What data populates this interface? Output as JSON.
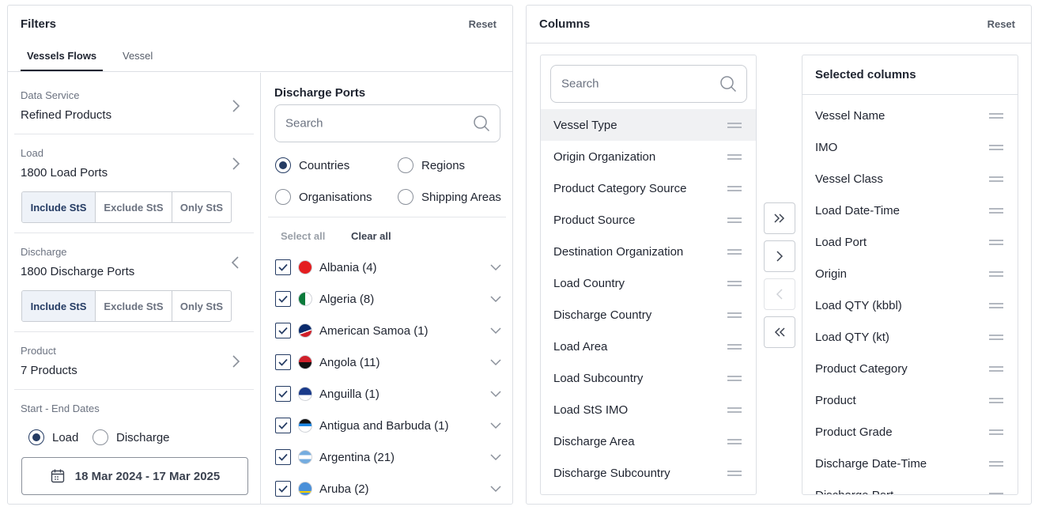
{
  "filters": {
    "title": "Filters",
    "reset": "Reset",
    "tabs": [
      {
        "label": "Vessels Flows",
        "active": true
      },
      {
        "label": "Vessel",
        "active": false
      }
    ],
    "data_service": {
      "label": "Data Service",
      "value": "Refined Products"
    },
    "load": {
      "label": "Load",
      "value": "1800 Load Ports"
    },
    "discharge": {
      "label": "Discharge",
      "value": "1800 Discharge Ports"
    },
    "sts_options": [
      "Include StS",
      "Exclude StS",
      "Only StS"
    ],
    "product": {
      "label": "Product",
      "value": "7 Products"
    },
    "dates": {
      "label": "Start - End Dates",
      "options": [
        "Load",
        "Discharge"
      ],
      "selected": "Load",
      "range": "18 Mar 2024 - 17 Mar 2025"
    },
    "discharge_ports": {
      "title": "Discharge Ports",
      "search_placeholder": "Search",
      "group_options": [
        "Countries",
        "Regions",
        "Organisations",
        "Shipping Areas"
      ],
      "selected_group": "Countries",
      "select_all": "Select all",
      "clear_all": "Clear all",
      "countries": [
        {
          "name": "Albania (4)",
          "checked": true
        },
        {
          "name": "Algeria (8)",
          "checked": true
        },
        {
          "name": "American Samoa (1)",
          "checked": true
        },
        {
          "name": "Angola (11)",
          "checked": true
        },
        {
          "name": "Anguilla (1)",
          "checked": true
        },
        {
          "name": "Antigua and Barbuda (1)",
          "checked": true
        },
        {
          "name": "Argentina (21)",
          "checked": true
        },
        {
          "name": "Aruba (2)",
          "checked": true
        }
      ]
    }
  },
  "columns": {
    "title": "Columns",
    "reset": "Reset",
    "search_placeholder": "Search",
    "available": [
      "Vessel Type",
      "Origin Organization",
      "Product Category Source",
      "Product Source",
      "Destination Organization",
      "Load Country",
      "Discharge Country",
      "Load Area",
      "Load Subcountry",
      "Load StS IMO",
      "Discharge Area",
      "Discharge Subcountry"
    ],
    "selected_title": "Selected columns",
    "selected": [
      "Vessel Name",
      "IMO",
      "Vessel Class",
      "Load Date-Time",
      "Load Port",
      "Origin",
      "Load QTY (kbbl)",
      "Load QTY (kt)",
      "Product Category",
      "Product",
      "Product Grade",
      "Discharge Date-Time",
      "Discharge Port"
    ]
  },
  "colors": {
    "accent": "#243b63",
    "border": "#dcdfe4",
    "muted_text": "#6b7280"
  }
}
